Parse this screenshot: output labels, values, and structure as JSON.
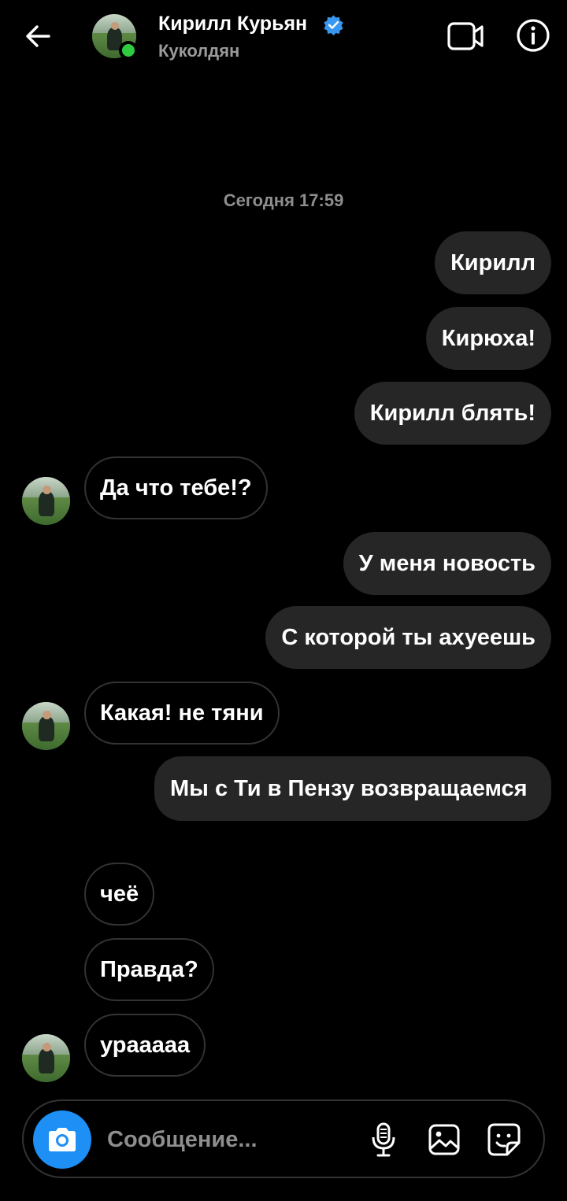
{
  "header": {
    "name": "Кирилл Курьян",
    "username": "Куколдян",
    "back_icon": "arrow-left-icon",
    "video_icon": "video-camera-icon",
    "info_icon": "info-icon",
    "verified_icon": "verified-badge-icon",
    "online_color": "#2ecc40"
  },
  "timestamp": "Сегодня 17:59",
  "messages": [
    {
      "side": "out",
      "text": "Кирилл"
    },
    {
      "side": "out",
      "text": "Кирюха!"
    },
    {
      "side": "out",
      "text": "Кирилл блять!"
    },
    {
      "side": "in",
      "text": "Да что тебе!?"
    },
    {
      "side": "out",
      "text": "У меня новость"
    },
    {
      "side": "out",
      "text": "С которой ты ахуеешь"
    },
    {
      "side": "in",
      "text": "Какая! не тяни"
    },
    {
      "side": "out",
      "text": "Мы с Ти в Пензу возвращаемся"
    },
    {
      "side": "in",
      "text": "чеё"
    },
    {
      "side": "in",
      "text": "Правда?"
    },
    {
      "side": "in",
      "text": "урааааа"
    }
  ],
  "composer": {
    "placeholder": "Сообщение...",
    "camera_icon": "camera-icon",
    "mic_icon": "microphone-icon",
    "gallery_icon": "image-icon",
    "sticker_icon": "sticker-icon",
    "camera_color": "#1d8ff5"
  },
  "colors": {
    "background": "#000000",
    "outgoing_bubble": "#262626",
    "verified": "#3897f0"
  }
}
